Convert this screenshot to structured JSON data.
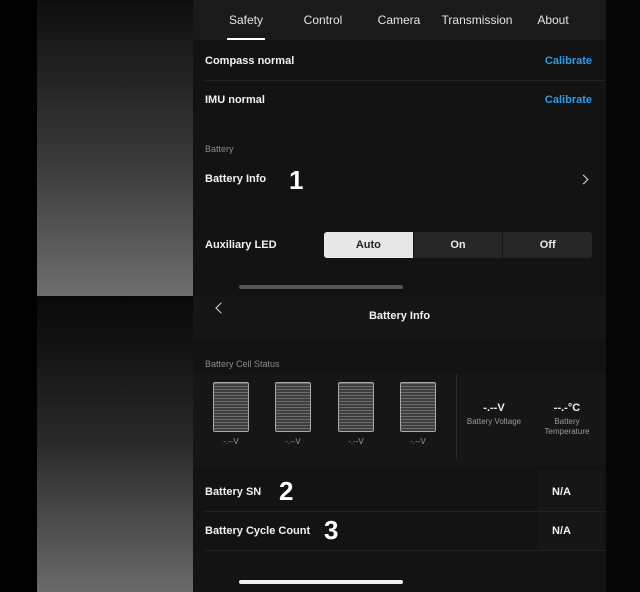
{
  "tabs": [
    {
      "label": "Safety",
      "active": true
    },
    {
      "label": "Control"
    },
    {
      "label": "Camera"
    },
    {
      "label": "Transmission"
    },
    {
      "label": "About"
    }
  ],
  "compass": {
    "label": "Compass normal",
    "action": "Calibrate"
  },
  "imu": {
    "label": "IMU normal",
    "action": "Calibrate"
  },
  "battery_section": {
    "caption": "Battery",
    "info_label": "Battery Info"
  },
  "aux_led": {
    "label": "Auxiliary LED",
    "options": [
      "Auto",
      "On",
      "Off"
    ],
    "selected": "Auto"
  },
  "battery_info": {
    "title": "Battery Info",
    "cell_status_caption": "Battery Cell Status",
    "cells": [
      "-.--V",
      "-.--V",
      "-.--V",
      "-.--V"
    ],
    "voltage": {
      "value": "-.--V",
      "label": "Battery Voltage"
    },
    "temperature": {
      "value": "--.-°C",
      "label_line1": "Battery",
      "label_line2": "Temperature"
    },
    "sn": {
      "label": "Battery SN",
      "value": "N/A"
    },
    "cycle": {
      "label": "Battery Cycle Count",
      "value": "N/A"
    }
  },
  "markers": [
    "1",
    "2",
    "3"
  ],
  "colors": {
    "accent": "#2f9dea",
    "panel": "#131313",
    "selected_segment": "#e8e8e8"
  }
}
